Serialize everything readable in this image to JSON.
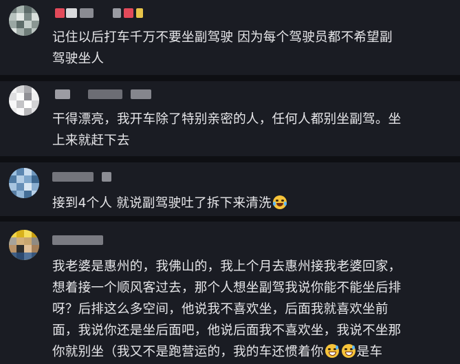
{
  "comments": [
    {
      "lines": [
        "记住以后打车千万不要坐副驾驶   因为每个驾驶员都不希望副",
        "驾驶坐人"
      ]
    },
    {
      "lines": [
        "干得漂亮，我开车除了特别亲密的人，任何人都别坐副驾。坐",
        "上来就赶下去"
      ]
    },
    {
      "lines": [
        "接到4个人 就说副驾驶吐了拆下来清洗"
      ],
      "emoji": "laughing-crying-emoji"
    },
    {
      "lines": [
        "我老婆是惠州的，我佛山的，我上个月去惠州接我老婆回家，",
        "想着接一个顺风客过去，那个人想坐副驾我说你能不能坐后排",
        "呀？后排这么多空间，他说我不喜欢坐，后面我就喜欢坐前",
        "面，我说你还是坐后面吧，他说后面我不喜欢坐，我说不坐那",
        "你就别坐（我又不是跑营运的，我的车还惯着你",
        "是车"
      ],
      "emoji": "grinning-sweat-emoji"
    }
  ],
  "colors": {
    "background": "#0e0f13",
    "card": "#1a1c23",
    "text": "#e6e6e9"
  }
}
